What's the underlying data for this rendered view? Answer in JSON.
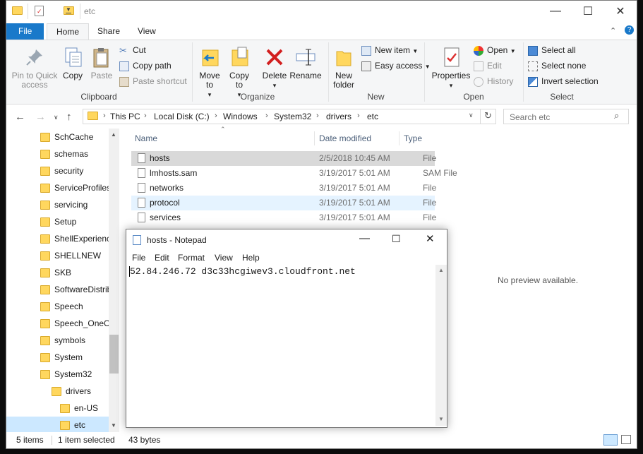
{
  "explorer": {
    "title": "etc",
    "window_buttons": {
      "minimize": "—",
      "maximize": "☐",
      "close": "✕"
    },
    "menu_tabs": {
      "file": "File",
      "home": "Home",
      "share": "Share",
      "view": "View"
    },
    "ribbon": {
      "clipboard": {
        "pin_label": "Pin to Quick access",
        "copy_label": "Copy",
        "paste_label": "Paste",
        "cut_label": "Cut",
        "copy_path_label": "Copy path",
        "paste_shortcut_label": "Paste shortcut",
        "group_label": "Clipboard"
      },
      "organize": {
        "move_to_label": "Move to",
        "copy_to_label": "Copy to",
        "delete_label": "Delete",
        "rename_label": "Rename",
        "group_label": "Organize"
      },
      "new": {
        "new_folder_label": "New folder",
        "new_item_label": "New item",
        "easy_access_label": "Easy access",
        "group_label": "New"
      },
      "open": {
        "properties_label": "Properties",
        "open_label": "Open",
        "edit_label": "Edit",
        "history_label": "History",
        "group_label": "Open"
      },
      "select": {
        "select_all_label": "Select all",
        "select_none_label": "Select none",
        "invert_selection_label": "Invert selection",
        "group_label": "Select"
      }
    },
    "address": {
      "crumbs": [
        "This PC",
        "Local Disk (C:)",
        "Windows",
        "System32",
        "drivers",
        "etc"
      ],
      "search_placeholder": "Search etc"
    },
    "nav_items": [
      {
        "label": "SchCache"
      },
      {
        "label": "schemas"
      },
      {
        "label": "security"
      },
      {
        "label": "ServiceProfiles"
      },
      {
        "label": "servicing"
      },
      {
        "label": "Setup"
      },
      {
        "label": "ShellExperienc"
      },
      {
        "label": "SHELLNEW"
      },
      {
        "label": "SKB"
      },
      {
        "label": "SoftwareDistrib"
      },
      {
        "label": "Speech"
      },
      {
        "label": "Speech_OneCo"
      },
      {
        "label": "symbols"
      },
      {
        "label": "System"
      },
      {
        "label": "System32"
      },
      {
        "label": "drivers"
      },
      {
        "label": "en-US"
      },
      {
        "label": "etc"
      }
    ],
    "columns": {
      "name": "Name",
      "date": "Date modified",
      "type": "Type"
    },
    "files": [
      {
        "name": "hosts",
        "date": "2/5/2018 10:45 AM",
        "type": "File"
      },
      {
        "name": "lmhosts.sam",
        "date": "3/19/2017 5:01 AM",
        "type": "SAM File"
      },
      {
        "name": "networks",
        "date": "3/19/2017 5:01 AM",
        "type": "File"
      },
      {
        "name": "protocol",
        "date": "3/19/2017 5:01 AM",
        "type": "File"
      },
      {
        "name": "services",
        "date": "3/19/2017 5:01 AM",
        "type": "File"
      }
    ],
    "preview_text": "No preview available.",
    "status": {
      "items": "5 items",
      "selected": "1 item selected",
      "size": "43 bytes"
    }
  },
  "notepad": {
    "title": "hosts - Notepad",
    "menu": {
      "file": "File",
      "edit": "Edit",
      "format": "Format",
      "view": "View",
      "help": "Help"
    },
    "content": "52.84.246.72 d3c33hcgiwev3.cloudfront.net"
  },
  "colors": {
    "accent": "#1979ca",
    "folder": "#ffd75e",
    "selection": "#cce8ff"
  }
}
